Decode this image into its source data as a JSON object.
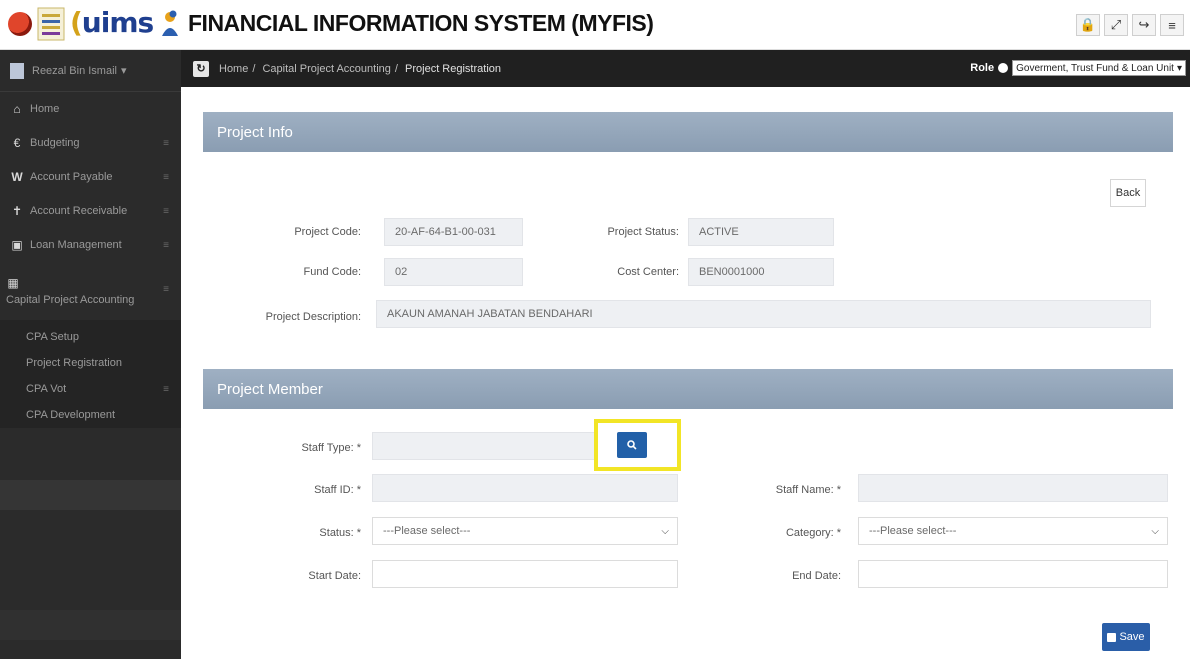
{
  "header": {
    "logo_text": "uims",
    "title": "FINANCIAL INFORMATION SYSTEM (MYFIS)",
    "icons": [
      "lock-icon",
      "expand-icon",
      "logout-icon",
      "menu-icon"
    ]
  },
  "sidebar": {
    "user_name": "Reezal Bin Ismail",
    "items": [
      {
        "label": "Home",
        "icon": "home-icon"
      },
      {
        "label": "Budgeting",
        "icon": "euro-icon"
      },
      {
        "label": "Account Payable",
        "icon": "w-icon"
      },
      {
        "label": "Account Receivable",
        "icon": "pin-icon"
      },
      {
        "label": "Loan Management",
        "icon": "loan-icon"
      },
      {
        "label": "Capital Project Accounting",
        "icon": "building-icon"
      }
    ],
    "subitems": [
      {
        "label": "CPA Setup"
      },
      {
        "label": "Project Registration"
      },
      {
        "label": "CPA Vot"
      },
      {
        "label": "CPA Development"
      }
    ]
  },
  "breadcrumb": {
    "items": [
      "Home",
      "Capital Project Accounting",
      "Project Registration"
    ],
    "role_label": "Role",
    "role_value": "Goverment, Trust Fund & Loan Unit"
  },
  "project_info": {
    "title": "Project Info",
    "back_label": "Back",
    "project_code_label": "Project Code:",
    "project_code": "20-AF-64-B1-00-031",
    "project_status_label": "Project Status:",
    "project_status": "ACTIVE",
    "fund_code_label": "Fund Code:",
    "fund_code": "02",
    "cost_center_label": "Cost Center:",
    "cost_center": "BEN0001000",
    "description_label": "Project Description:",
    "description": "AKAUN AMANAH JABATAN BENDAHARI"
  },
  "project_member": {
    "title": "Project Member",
    "staff_type_label": "Staff Type: *",
    "staff_type": "",
    "staff_id_label": "Staff ID: *",
    "staff_id": "",
    "staff_name_label": "Staff Name: *",
    "staff_name": "",
    "status_label": "Status: *",
    "status_value": "---Please select---",
    "category_label": "Category: *",
    "category_value": "---Please select---",
    "start_date_label": "Start Date:",
    "start_date": "",
    "end_date_label": "End Date:",
    "end_date": "",
    "save_label": "Save",
    "highlight_color": "#f2e526"
  }
}
